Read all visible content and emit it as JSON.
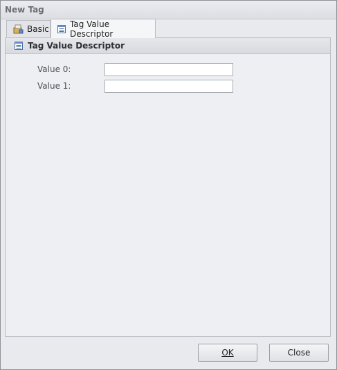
{
  "window": {
    "title": "New Tag"
  },
  "tabs": [
    {
      "label": "Basic",
      "icon": "basic-icon"
    },
    {
      "label": "Tag Value Descriptor",
      "icon": "descriptor-icon",
      "active": true
    }
  ],
  "group": {
    "title": "Tag Value Descriptor",
    "icon": "descriptor-icon"
  },
  "fields": [
    {
      "label": "Value 0:",
      "value": ""
    },
    {
      "label": "Value 1:",
      "value": ""
    }
  ],
  "buttons": {
    "ok_label": "OK",
    "close_label": "Close"
  }
}
